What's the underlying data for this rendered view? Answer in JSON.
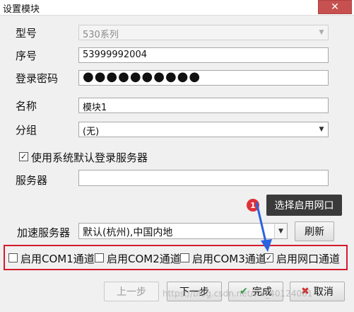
{
  "window": {
    "title": "设置模块",
    "close_glyph": "✕"
  },
  "form": {
    "model": {
      "label": "型号",
      "value": "530系列"
    },
    "serial": {
      "label": "序号",
      "value": "53999992004"
    },
    "password": {
      "label": "登录密码",
      "value": "●●●●●●●●●●"
    },
    "name": {
      "label": "名称",
      "value": "模块1"
    },
    "group": {
      "label": "分组",
      "value": "(无)"
    },
    "use_default_server": {
      "label": "使用系统默认登录服务器",
      "checked": true
    },
    "server": {
      "label": "服务器",
      "value": ""
    },
    "accel_server": {
      "label": "加速服务器",
      "value": "默认(杭州),中国内地",
      "refresh_label": "刷新"
    }
  },
  "channels": [
    {
      "label": "启用COM1通道",
      "checked": false
    },
    {
      "label": "启用COM2通道",
      "checked": false
    },
    {
      "label": "启用COM3通道",
      "checked": false
    },
    {
      "label": "启用网口通道",
      "checked": true
    }
  ],
  "annotation": {
    "badge": "1",
    "callout": "选择启用网口",
    "highlight_color": "#d41b2c",
    "arrow_color": "#2a63e0"
  },
  "buttons": {
    "prev": "上一步",
    "next": "下一步",
    "finish": "完成",
    "cancel": "取消"
  },
  "watermark": "https://blog.csdn.net/wx_40124081"
}
